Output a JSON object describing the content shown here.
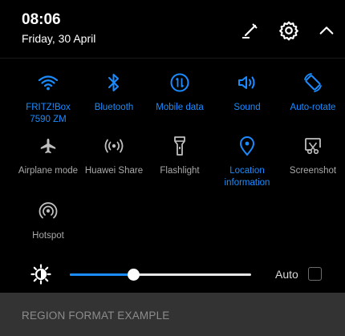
{
  "header": {
    "time": "08:06",
    "date": "Friday, 30 April",
    "edit_icon": "pencil-edit-icon",
    "settings_icon": "gear-icon",
    "collapse_icon": "chevron-up-icon"
  },
  "tiles": [
    {
      "label": "FRITZ!Box\n7590 ZM",
      "icon": "wifi-icon",
      "active": true
    },
    {
      "label": "Bluetooth",
      "icon": "bluetooth-icon",
      "active": true
    },
    {
      "label": "Mobile data",
      "icon": "mobile-data-icon",
      "active": true
    },
    {
      "label": "Sound",
      "icon": "sound-icon",
      "active": true
    },
    {
      "label": "Auto-rotate",
      "icon": "auto-rotate-icon",
      "active": true
    },
    {
      "label": "Airplane mode",
      "icon": "airplane-icon",
      "active": false
    },
    {
      "label": "Huawei Share",
      "icon": "huawei-share-icon",
      "active": false
    },
    {
      "label": "Flashlight",
      "icon": "flashlight-icon",
      "active": false
    },
    {
      "label": "Location\ninformation",
      "icon": "location-icon",
      "active": true
    },
    {
      "label": "Screenshot",
      "icon": "screenshot-icon",
      "active": false
    },
    {
      "label": "Hotspot",
      "icon": "hotspot-icon",
      "active": false
    }
  ],
  "brightness": {
    "level": 0.35,
    "icon": "brightness-icon",
    "auto_label": "Auto",
    "auto_checked": false
  },
  "background_app": {
    "text": "REGION FORMAT EXAMPLE"
  },
  "colors": {
    "accent": "#1a8cff",
    "inactive": "#a9a9a9",
    "panel_bg": "#000000",
    "underlay_bg": "#333333"
  }
}
